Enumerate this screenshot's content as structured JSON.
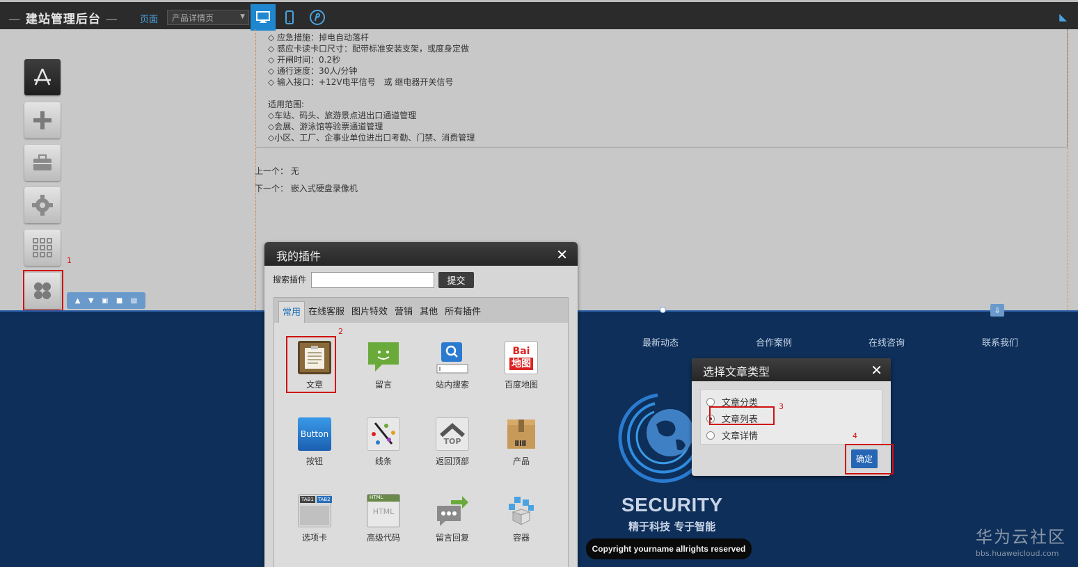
{
  "topbar": {
    "brand": "建站管理后台",
    "page_label": "页面",
    "page_select_value": "产品详情页"
  },
  "spec_lines": [
    "◇ 应急措施：掉电自动落杆",
    "◇ 感应卡读卡口尺寸：配带标准安装支架，或度身定做",
    "◇ 开闸时间：0.2秒",
    "◇ 通行速度：30人/分钟",
    "◇ 输入接口：+12V电平信号　或 继电器开关信号",
    "",
    "适用范围:",
    "◇车站、码头、旅游景点进出口通道管理",
    "◇会展、游泳馆等验票通道管理",
    "◇小区、工厂、企事业单位进出口考勤、门禁、消费管理"
  ],
  "nav_prev": "上一个： 无",
  "nav_next": "下一个： 嵌入式硬盘录像机",
  "annotations": [
    "1",
    "2",
    "3",
    "4"
  ],
  "footer": {
    "links": [
      "最新动态",
      "合作案例",
      "在线咨询",
      "联系我们"
    ],
    "brand": "SECURITY",
    "slogan": "精于科技 专于智能",
    "copyright": "Copyright yourname allrights reserved"
  },
  "watermark": {
    "title": "华为云社区",
    "url": "bbs.huaweicloud.com"
  },
  "plugin_dialog": {
    "title": "我的插件",
    "search_label": "搜索插件",
    "submit_label": "提交",
    "tabs": [
      "常用",
      "在线客服",
      "图片特效",
      "营销",
      "其他",
      "所有插件"
    ],
    "items": [
      {
        "label": "文章",
        "icon": "article-icon"
      },
      {
        "label": "留言",
        "icon": "message-icon"
      },
      {
        "label": "站内搜索",
        "icon": "site-search-icon"
      },
      {
        "label": "百度地图",
        "icon": "baidu-map-icon"
      },
      {
        "label": "按钮",
        "icon": "button-icon"
      },
      {
        "label": "线条",
        "icon": "line-icon"
      },
      {
        "label": "返回顶部",
        "icon": "back-to-top-icon"
      },
      {
        "label": "产品",
        "icon": "product-icon"
      },
      {
        "label": "选项卡",
        "icon": "tabs-icon"
      },
      {
        "label": "高级代码",
        "icon": "html-code-icon"
      },
      {
        "label": "留言回复",
        "icon": "reply-icon"
      },
      {
        "label": "容器",
        "icon": "container-icon"
      }
    ],
    "icon_texts": {
      "button": "Button",
      "baidu_top": "Bai",
      "baidu_bottom": "地图",
      "top": "TOP",
      "html": "HTML",
      "tab1": "TAB1",
      "tab2": "TAB2"
    }
  },
  "type_dialog": {
    "title": "选择文章类型",
    "options": [
      "文章分类",
      "文章列表",
      "文章详情"
    ],
    "selected_index": 1,
    "confirm_label": "确定"
  },
  "colors": {
    "footer_bg": "#0e2f59",
    "accent_blue": "#1e87d0",
    "annotation_red": "#d01010"
  }
}
